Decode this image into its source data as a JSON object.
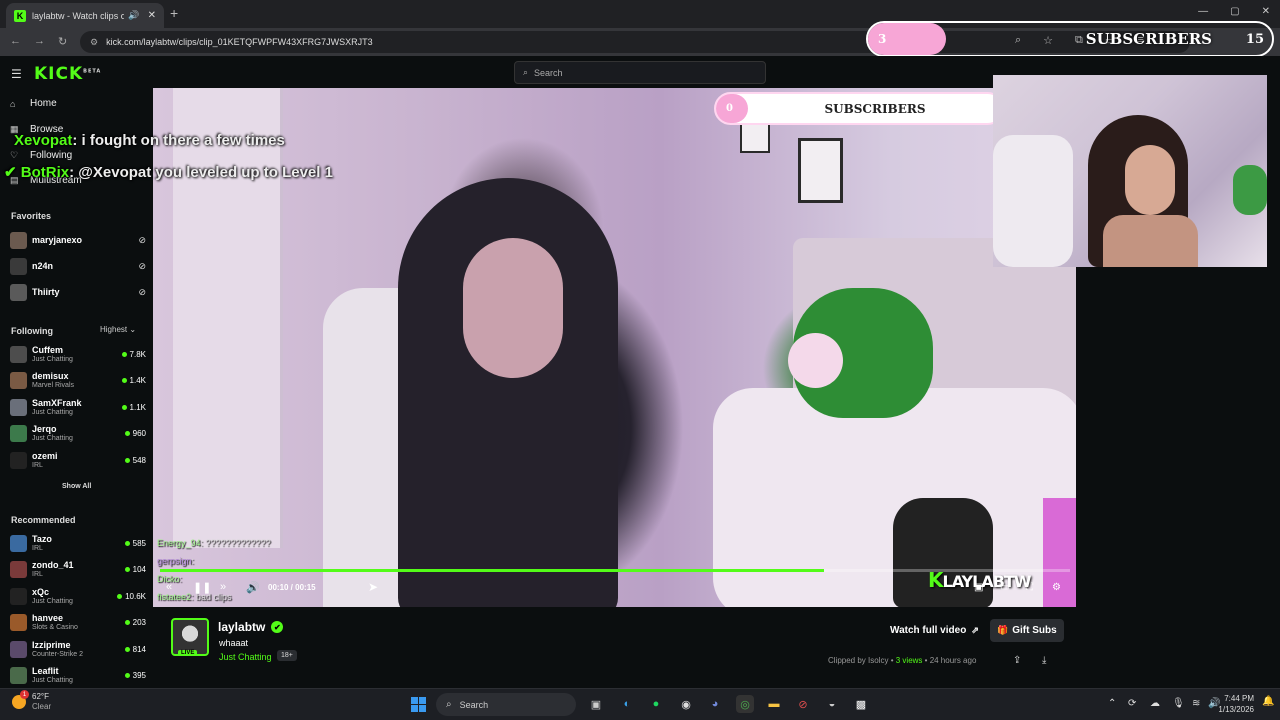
{
  "browser": {
    "tab_title": "laylabtw - Watch clips on K",
    "tab_favicon": "K",
    "url": "kick.com/laylabtw/clips/clip_01KETQFWPFW43XFRG7JWSXRJT3",
    "new_tab": "+",
    "minimize": "—",
    "maximize": "▢",
    "close": "✕",
    "tab_close": "✕"
  },
  "overlay_top": {
    "count": "3",
    "label": "SUBSCRIBERS",
    "extra": "15"
  },
  "overlay_mid": {
    "count": "0",
    "label": "SUBSCRIBERS"
  },
  "header": {
    "logo": "KICK",
    "logo_sup": "BETA",
    "search_placeholder": "Search"
  },
  "nav": {
    "home": "Home",
    "browse": "Browse",
    "following": "Following",
    "multistream": "Multistream"
  },
  "overlay_chat": [
    {
      "user": "Xevopat",
      "msg": ": i fought on there a few times"
    },
    {
      "user": "BotRix",
      "msg": ": @Xevopat you leveled up to Level 1"
    }
  ],
  "favorites": {
    "title": "Favorites",
    "items": [
      {
        "name": "maryjanexo",
        "color": "#6b5a4f"
      },
      {
        "name": "n24n",
        "color": "#3a3a3a"
      },
      {
        "name": "Thiirty",
        "color": "#5a5a5a"
      }
    ]
  },
  "following": {
    "title": "Following",
    "sort": "Highest",
    "show_all": "Show All",
    "items": [
      {
        "name": "Cuffem",
        "category": "Just Chatting",
        "viewers": "7.8K",
        "color": "#4d4d4d"
      },
      {
        "name": "demisux",
        "category": "Marvel Rivals",
        "viewers": "1.4K",
        "color": "#7a5a44"
      },
      {
        "name": "SamXFrank",
        "category": "Just Chatting",
        "viewers": "1.1K",
        "color": "#6a6f7a"
      },
      {
        "name": "Jerqo",
        "category": "Just Chatting",
        "viewers": "960",
        "color": "#3c7a4b"
      },
      {
        "name": "ozemi",
        "category": "IRL",
        "viewers": "548",
        "color": "#222222"
      }
    ]
  },
  "recommended": {
    "title": "Recommended",
    "items": [
      {
        "name": "Tazo",
        "category": "IRL",
        "viewers": "585",
        "color": "#3a6aa0"
      },
      {
        "name": "zondo_41",
        "category": "IRL",
        "viewers": "104",
        "color": "#7a3a3a"
      },
      {
        "name": "xQc",
        "category": "Just Chatting",
        "viewers": "10.6K",
        "color": "#222222"
      },
      {
        "name": "hanvee",
        "category": "Slots & Casino",
        "viewers": "203",
        "color": "#9a5a2a"
      },
      {
        "name": "Izziprime",
        "category": "Counter-Strike 2",
        "viewers": "814",
        "color": "#5a4a6a"
      },
      {
        "name": "Leaflit",
        "category": "Just Chatting",
        "viewers": "395",
        "color": "#4a6a4a"
      }
    ]
  },
  "video": {
    "time": "00:10 / 00:15",
    "progress_fraction": 0.73,
    "watermark_k": "K",
    "watermark": "LAYLABTW",
    "chat": [
      {
        "user": "Energy_94",
        "msg": ": ?????????????"
      },
      {
        "user": "gerpsign",
        "msg": ":"
      },
      {
        "user": "Dicko",
        "msg": ":"
      },
      {
        "user": "fistatee2",
        "msg": ": bad clips"
      }
    ]
  },
  "clip": {
    "channel": "laylabtw",
    "title": "whaaat",
    "category": "Just Chatting",
    "age_badge": "18+",
    "live_badge": "LIVE",
    "watch_full": "Watch full video",
    "gift_subs": "Gift Subs",
    "clipped_by_label": "Clipped by",
    "clipped_by": "Isolcy",
    "views": "3 views",
    "age": "24 hours ago"
  },
  "taskbar": {
    "temp": "62°F",
    "weather": "Clear",
    "weather_badge": "1",
    "search": "Search",
    "time": "7:44 PM",
    "date": "1/13/2026"
  }
}
